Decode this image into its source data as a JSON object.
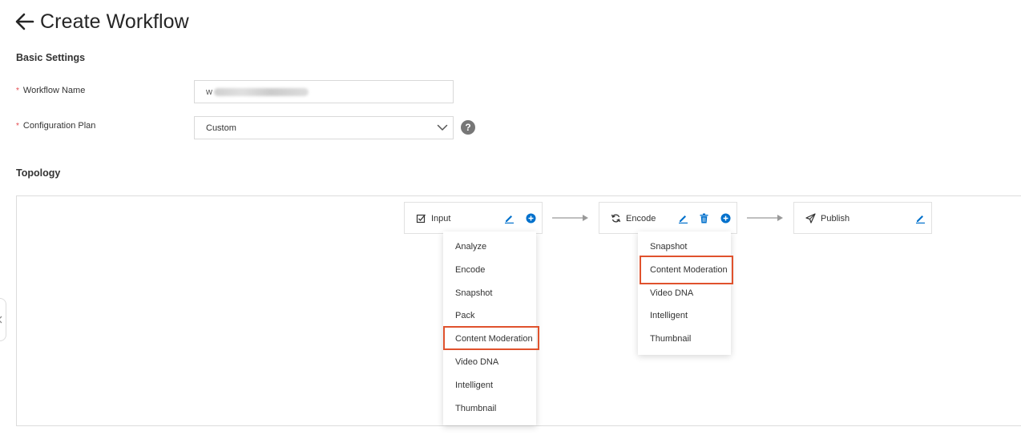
{
  "header": {
    "title": "Create Workflow"
  },
  "basic_settings": {
    "title": "Basic Settings",
    "workflow_name": {
      "label": "Workflow Name",
      "value": "w"
    },
    "configuration_plan": {
      "label": "Configuration Plan",
      "value": "Custom"
    }
  },
  "topology": {
    "title": "Topology",
    "nodes": [
      {
        "label": "Input",
        "icon": "input-checkbox-icon",
        "actions": [
          "edit-icon",
          "add-icon"
        ]
      },
      {
        "label": "Encode",
        "icon": "sync-icon",
        "actions": [
          "edit-icon",
          "delete-icon",
          "add-icon"
        ]
      },
      {
        "label": "Publish",
        "icon": "send-icon",
        "actions": [
          "edit-icon"
        ]
      }
    ],
    "input_menu": [
      "Analyze",
      "Encode",
      "Snapshot",
      "Pack",
      "Content Moderation",
      "Video DNA",
      "Intelligent",
      "Thumbnail"
    ],
    "encode_menu": [
      "Snapshot",
      "Content Moderation",
      "Video DNA",
      "Intelligent",
      "Thumbnail"
    ],
    "highlighted_option": "Content Moderation"
  },
  "colors": {
    "accent": "#0070cc",
    "highlight": "#e0522d",
    "required": "#e5484d"
  }
}
